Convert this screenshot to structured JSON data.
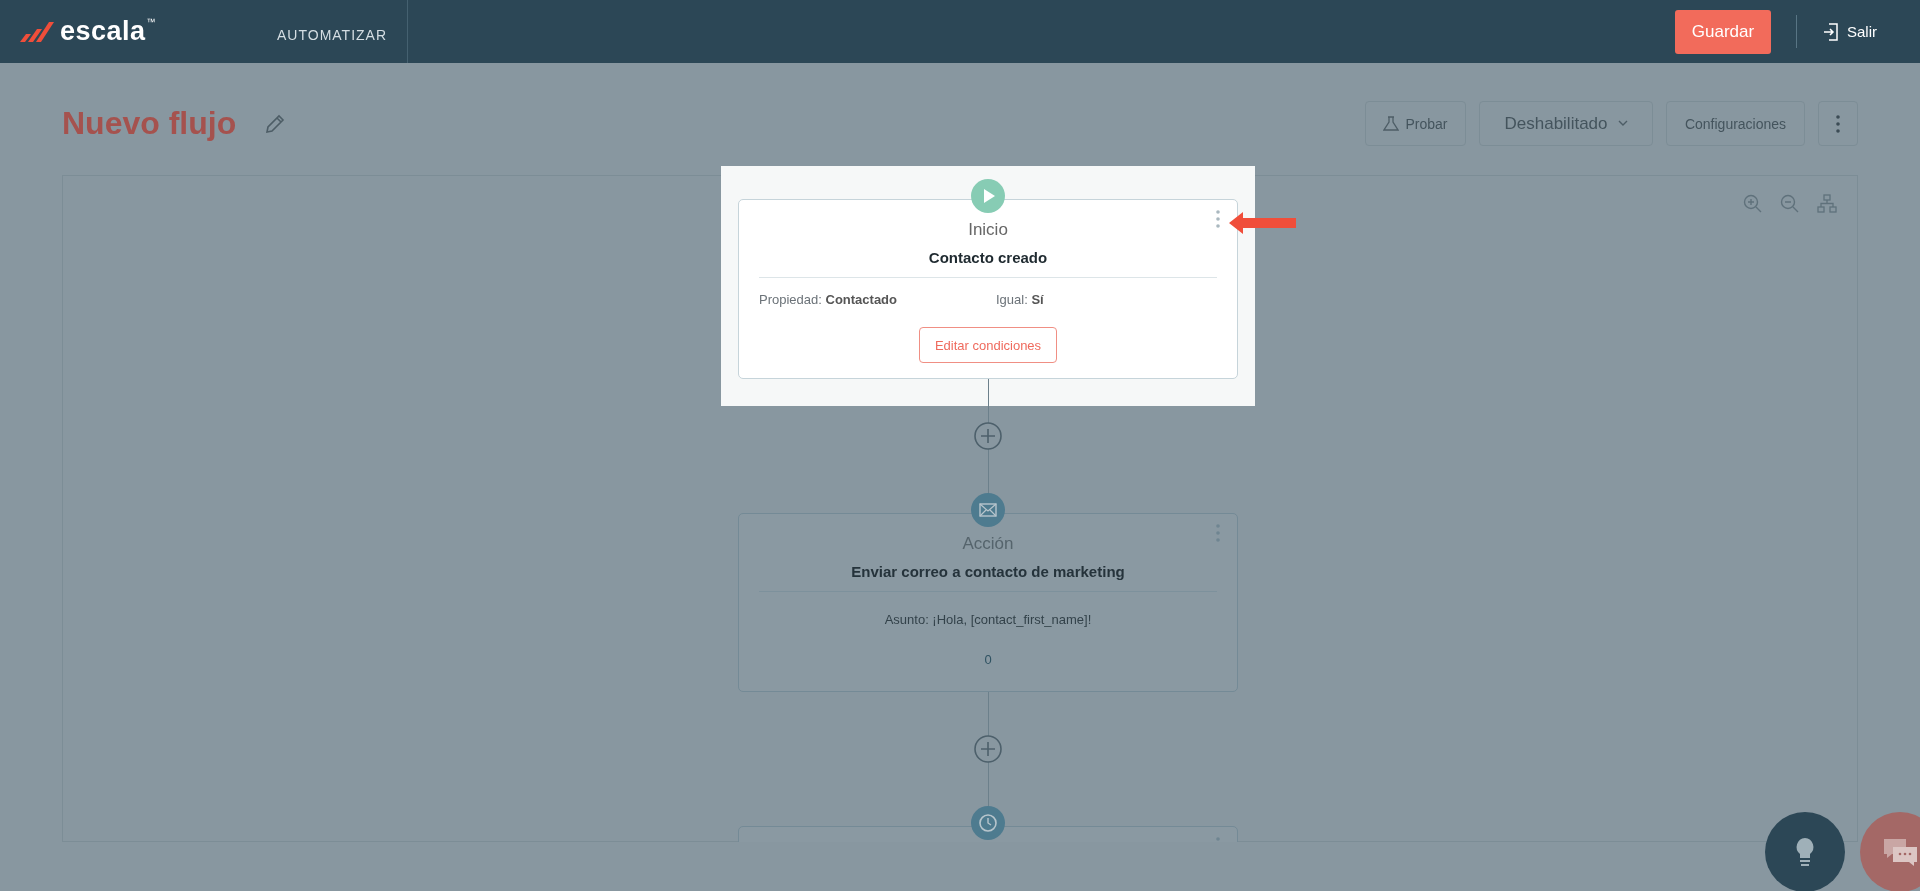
{
  "header": {
    "logo": "escala",
    "trademark": "™",
    "nav_item": "AUTOMATIZAR",
    "save_button": "Guardar",
    "exit_link": "Salir"
  },
  "title": "Nuevo flujo",
  "toolbar": {
    "test_button": "Probar",
    "status_dropdown": "Deshabilitado",
    "settings_button": "Configuraciones"
  },
  "nodes": [
    {
      "kind": "trigger",
      "highlighted": true,
      "type_label": "Inicio",
      "title": "Contacto creado",
      "conditions": [
        "Propiedad: **Contactado**",
        "Igual: **Sí**"
      ],
      "button": "Editar condiciones"
    },
    {
      "kind": "email",
      "highlighted": false,
      "type_label": "Acción",
      "title": "Enviar correo a contacto de marketing",
      "subject": "Asunto: ¡Hola, [contact_first_name]!",
      "count": "0"
    },
    {
      "kind": "delay",
      "highlighted": false
    }
  ]
}
